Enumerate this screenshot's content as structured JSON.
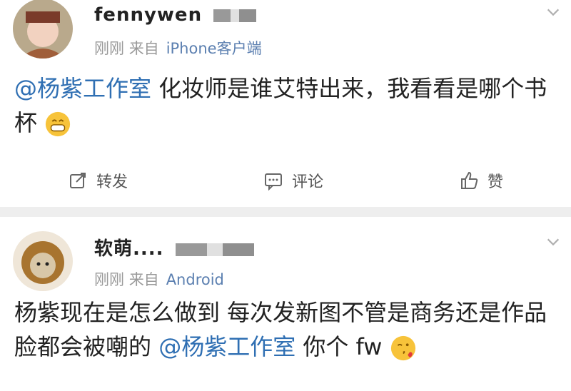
{
  "posts": [
    {
      "username": "fennywen",
      "time": "刚刚",
      "source_prefix": "来自",
      "client": "iPhone客户端",
      "content": {
        "mention": "@杨紫工作室",
        "text": " 化妆师是谁艾特出来，我看看是哪个书杯"
      },
      "actions": {
        "repost": "转发",
        "comment": "评论",
        "like": "赞"
      }
    },
    {
      "username": "软萌....",
      "time": "刚刚",
      "source_prefix": "来自",
      "client": "Android",
      "content": {
        "text1": "杨紫现在是怎么做到 每次发新图不管是商务还是作品 脸都会被嘲的 ",
        "mention": "@杨紫工作室",
        "text2": " 你个 fw"
      }
    }
  ],
  "icons": {
    "chevron": "chevron-down-icon",
    "repost": "repost-icon",
    "comment": "comment-icon",
    "like": "like-icon",
    "grin_emoji": "grin-emoji",
    "kiss_emoji": "kiss-emoji"
  },
  "colors": {
    "mention": "#2f6fb3",
    "meta": "#9a9a9a",
    "divider": "#eeeeee"
  }
}
